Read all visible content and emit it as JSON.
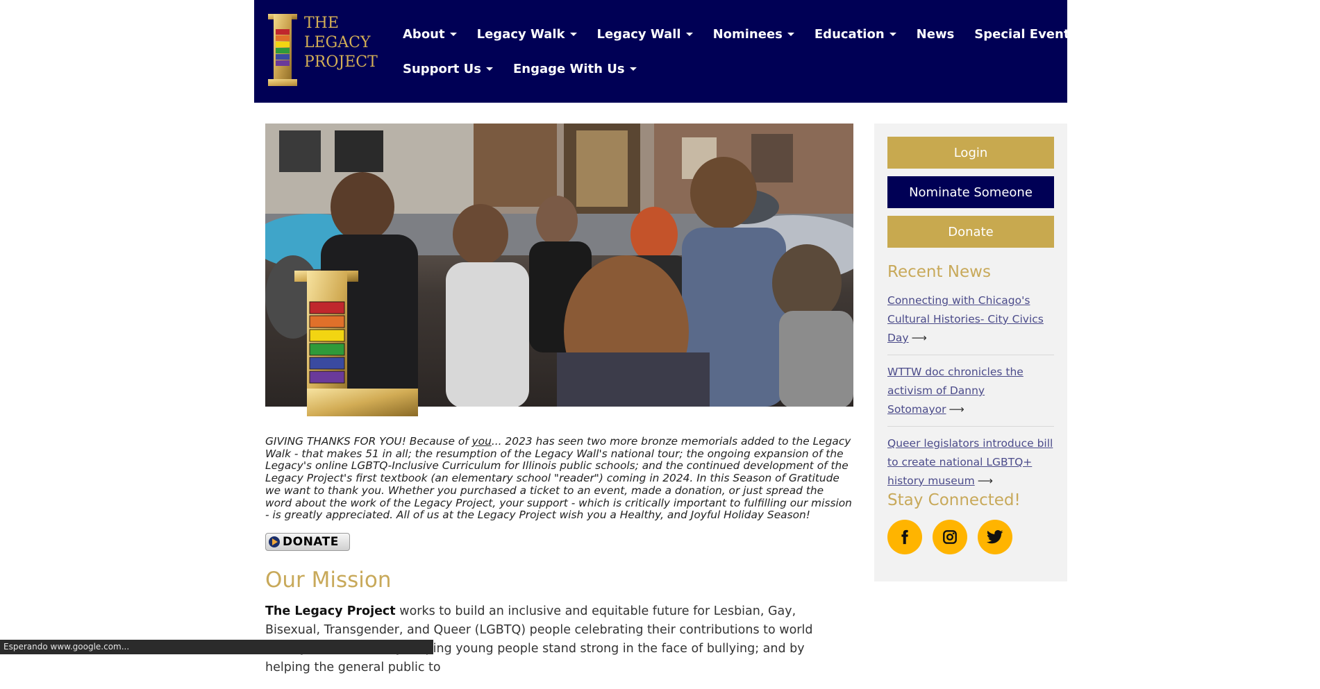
{
  "header": {
    "logo_lines": [
      "THE",
      "LEGACY",
      "PROJECT"
    ],
    "nav_row1": [
      {
        "label": "About",
        "dropdown": true
      },
      {
        "label": "Legacy Walk",
        "dropdown": true
      },
      {
        "label": "Legacy Wall",
        "dropdown": true
      },
      {
        "label": "Nominees",
        "dropdown": true
      },
      {
        "label": "Education",
        "dropdown": true
      },
      {
        "label": "News",
        "dropdown": false
      },
      {
        "label": "Special Events",
        "dropdown": false
      }
    ],
    "nav_row2": [
      {
        "label": "Support Us",
        "dropdown": true
      },
      {
        "label": "Engage With Us",
        "dropdown": true
      }
    ]
  },
  "main": {
    "intro_prefix": "GIVING THANKS FOR YOU! Because of ",
    "intro_emphasis": "you",
    "intro_suffix": "... 2023 has seen two more bronze memorials added to the Legacy Walk - that makes 51 in all; the resumption of the Legacy Wall's national tour; the ongoing expansion of the Legacy's online LGBTQ-Inclusive Curriculum for Illinois public schools; and the continued development of the Legacy Project's first textbook (an elementary school \"reader\") coming in 2024. In this Season of Gratitude we want to thank you. Whether you purchased a ticket to an event, made a donation, or just spread the word about the work of the Legacy Project, your support - which is critically important to fulfilling our mission - is greatly appreciated. All of us at the Legacy Project wish you a Healthy, and Joyful Holiday Season!",
    "donate_label": "DONATE",
    "mission_title": "Our Mission",
    "mission_bold": "The Legacy Project",
    "mission_text": " works to build an inclusive and equitable future for Lesbian, Gay, Bisexual, Transgender, and Queer (LGBTQ) people celebrating their contributions to world history and culture; by helping young people stand strong in the face of bullying; and by helping the general public to"
  },
  "sidebar": {
    "login_label": "Login",
    "nominate_label": "Nominate Someone",
    "donate_label": "Donate",
    "recent_news_title": "Recent News",
    "news": [
      {
        "title": "Connecting with Chicago's Cultural Histories- City Civics Day"
      },
      {
        "title": "WTTW doc chronicles the activism of Danny Sotomayor"
      },
      {
        "title": "Queer legislators introduce bill to create national LGBTQ+ history museum"
      }
    ],
    "arrow": "⟶",
    "stay_connected_title": "Stay Connected!",
    "social_icons": [
      "facebook-icon",
      "instagram-icon",
      "twitter-icon"
    ]
  },
  "status_bar": {
    "text": "Esperando www.google.com..."
  },
  "colors": {
    "navy": "#000055",
    "gold": "#c8a94f",
    "social": "#ffb400",
    "rainbow": [
      "#c0272d",
      "#e0702a",
      "#f2d512",
      "#2f9a3a",
      "#3a4aa0",
      "#6a3a9a"
    ]
  }
}
